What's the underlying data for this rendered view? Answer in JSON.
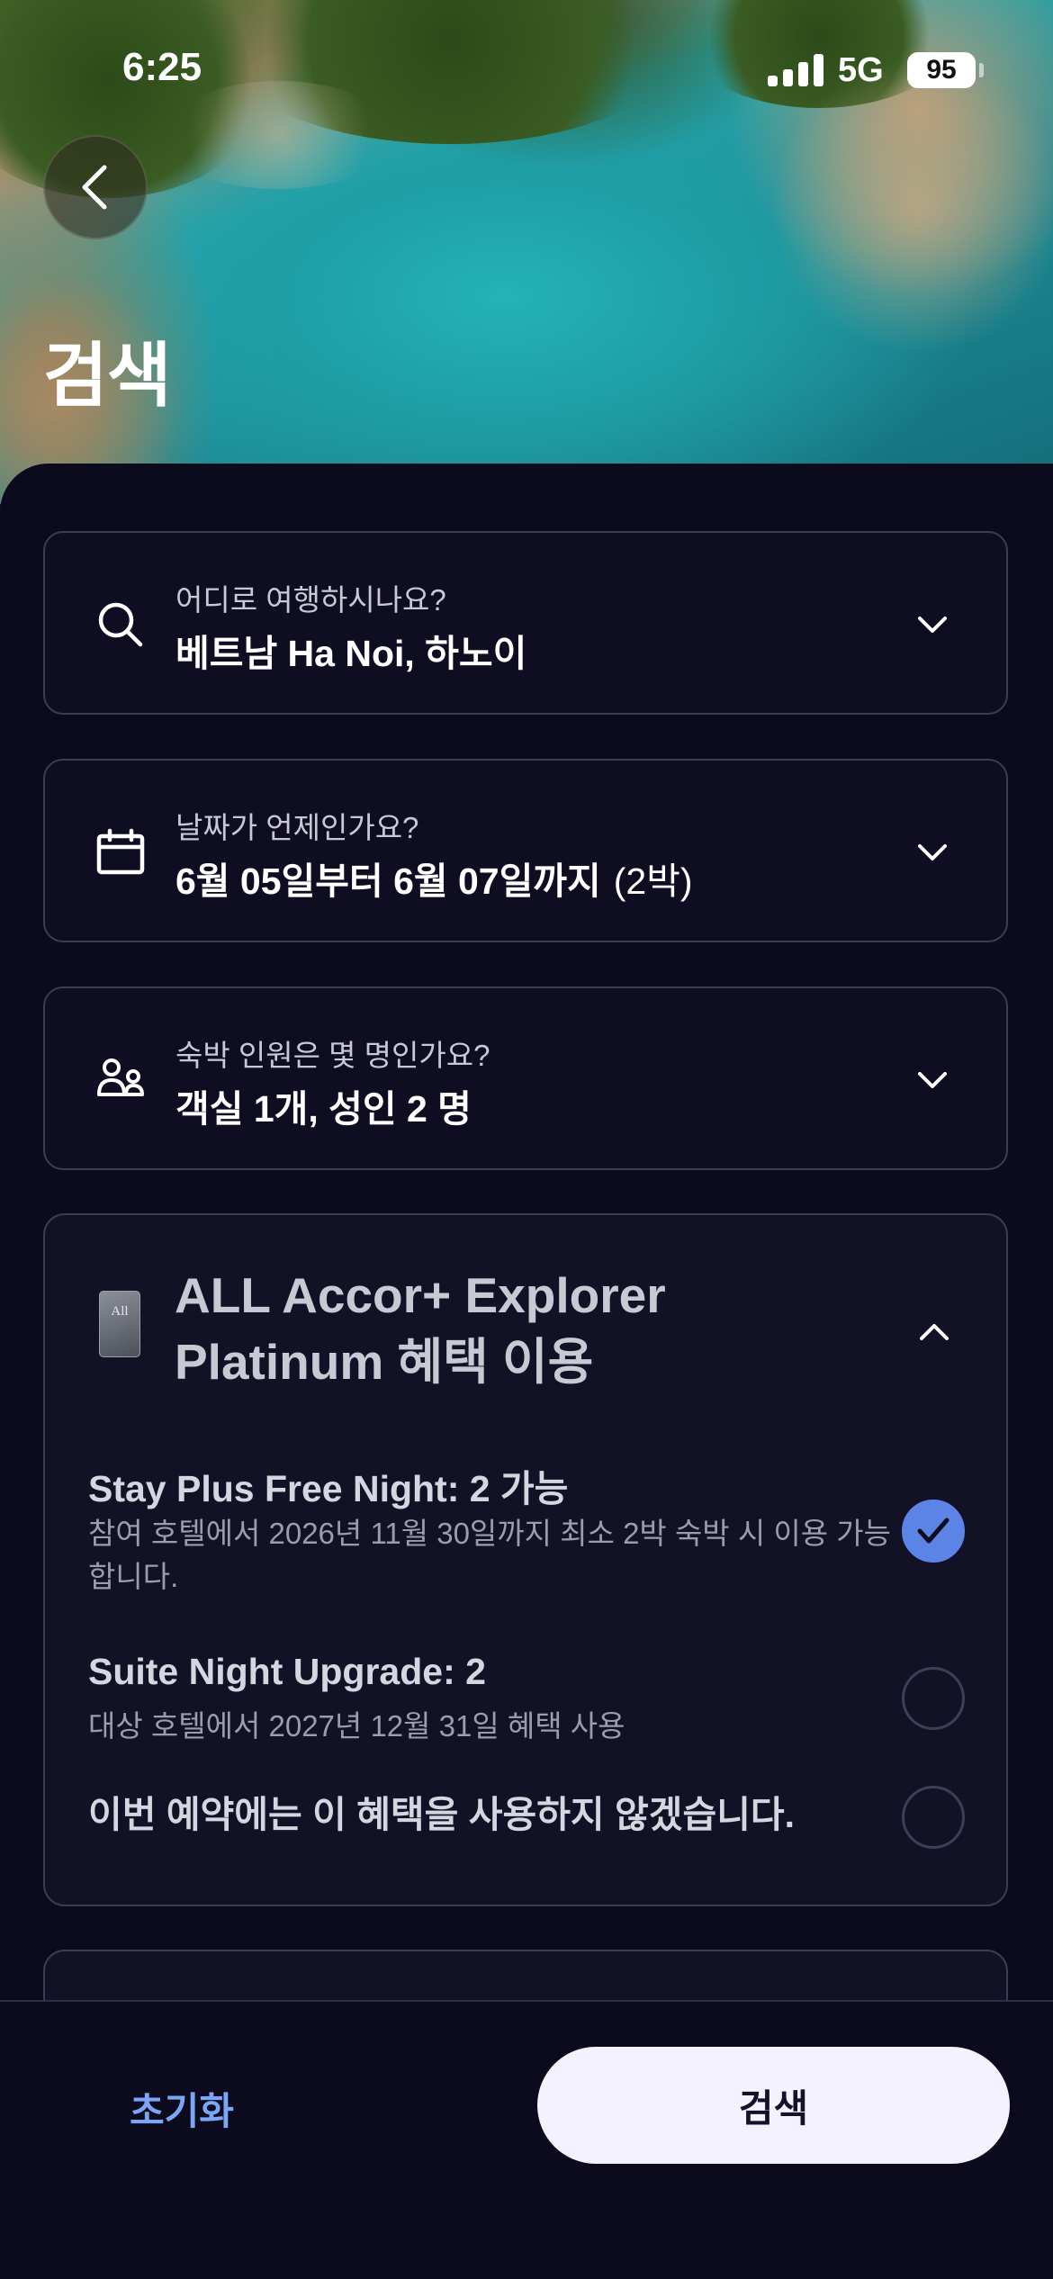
{
  "status_bar": {
    "time": "6:25",
    "network": "5G",
    "battery": "95"
  },
  "hero": {
    "title": "검색"
  },
  "destination": {
    "label": "어디로 여행하시나요?",
    "value": "베트남 Ha Noi, 하노이",
    "icon": "search-icon"
  },
  "dates": {
    "label": "날짜가 언제인가요?",
    "value": "6월 05일부터 6월 07일까지",
    "nights": "(2박)",
    "icon": "calendar-icon"
  },
  "guests": {
    "label": "숙박 인원은 몇 명인가요?",
    "value": "객실 1개, 성인 2 명",
    "icon": "guests-icon"
  },
  "benefits": {
    "card_logo_text": "All",
    "title": "ALL Accor+ Explorer Platinum 혜택 이용",
    "options": [
      {
        "title": "Stay Plus Free Night: 2 가능",
        "description": "참여 호텔에서 2026년 11월 30일까지 최소 2박 숙박 시 이용 가능합니다.",
        "selected": true
      },
      {
        "title": "Suite Night Upgrade: 2",
        "description": "대상 호텔에서 2027년 12월 31일 혜택 사용",
        "selected": false
      },
      {
        "title": "이번 예약에는 이 혜택을 사용하지 않겠습니다.",
        "description": "",
        "selected": false
      }
    ]
  },
  "footer": {
    "reset_label": "초기화",
    "search_label": "검색"
  },
  "colors": {
    "accent": "#5c84e6",
    "link": "#7aa6f5",
    "background": "#0c0b1d",
    "button_bg": "#f5f2ff"
  }
}
